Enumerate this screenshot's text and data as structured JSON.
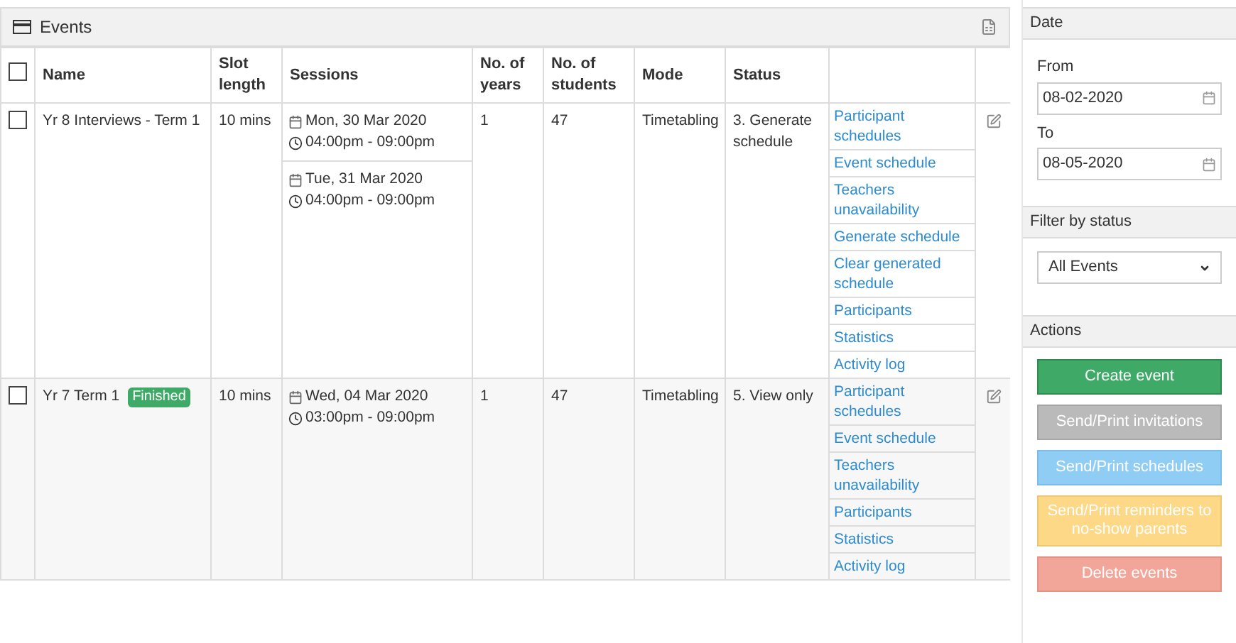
{
  "events_panel": {
    "title": "Events",
    "select_all": {
      "checked": false
    },
    "columns": [
      "Name",
      "Slot length",
      "Sessions",
      "No. of years",
      "No. of students",
      "Mode",
      "Status"
    ],
    "rows": [
      {
        "checked": false,
        "name": "Yr 8 Interviews - Term 1",
        "badge": null,
        "slot_length": "10 mins",
        "sessions": [
          {
            "date": "Mon, 30 Mar 2020",
            "time": "04:00pm - 09:00pm"
          },
          {
            "date": "Tue, 31 Mar 2020",
            "time": "04:00pm - 09:00pm"
          }
        ],
        "years": "1",
        "students": "47",
        "mode": "Timetabling",
        "status": "3. Generate schedule",
        "actions": [
          "Participant schedules",
          "Event schedule",
          "Teachers unavailability",
          "Generate schedule",
          "Clear generated schedule",
          "Participants",
          "Statistics",
          "Activity log"
        ]
      },
      {
        "checked": false,
        "name": "Yr 7 Term 1",
        "badge": "Finished",
        "slot_length": "10 mins",
        "sessions": [
          {
            "date": "Wed, 04 Mar 2020",
            "time": "03:00pm - 09:00pm"
          }
        ],
        "years": "1",
        "students": "47",
        "mode": "Timetabling",
        "status": "5. View only",
        "actions": [
          "Participant schedules",
          "Event schedule",
          "Teachers unavailability",
          "Participants",
          "Statistics",
          "Activity log"
        ]
      }
    ]
  },
  "sidebar": {
    "date_section": {
      "title": "Date",
      "from_label": "From",
      "from_value": "08-02-2020",
      "to_label": "To",
      "to_value": "08-05-2020"
    },
    "filter_section": {
      "title": "Filter by status",
      "value": "All Events"
    },
    "actions_section": {
      "title": "Actions",
      "buttons": [
        {
          "label": "Create event",
          "kind": "create"
        },
        {
          "label": "Send/Print invitations",
          "kind": "invitations"
        },
        {
          "label": "Send/Print schedules",
          "kind": "schedules"
        },
        {
          "label": "Send/Print reminders to no-show parents",
          "kind": "reminders"
        },
        {
          "label": "Delete events",
          "kind": "delete"
        }
      ]
    }
  }
}
